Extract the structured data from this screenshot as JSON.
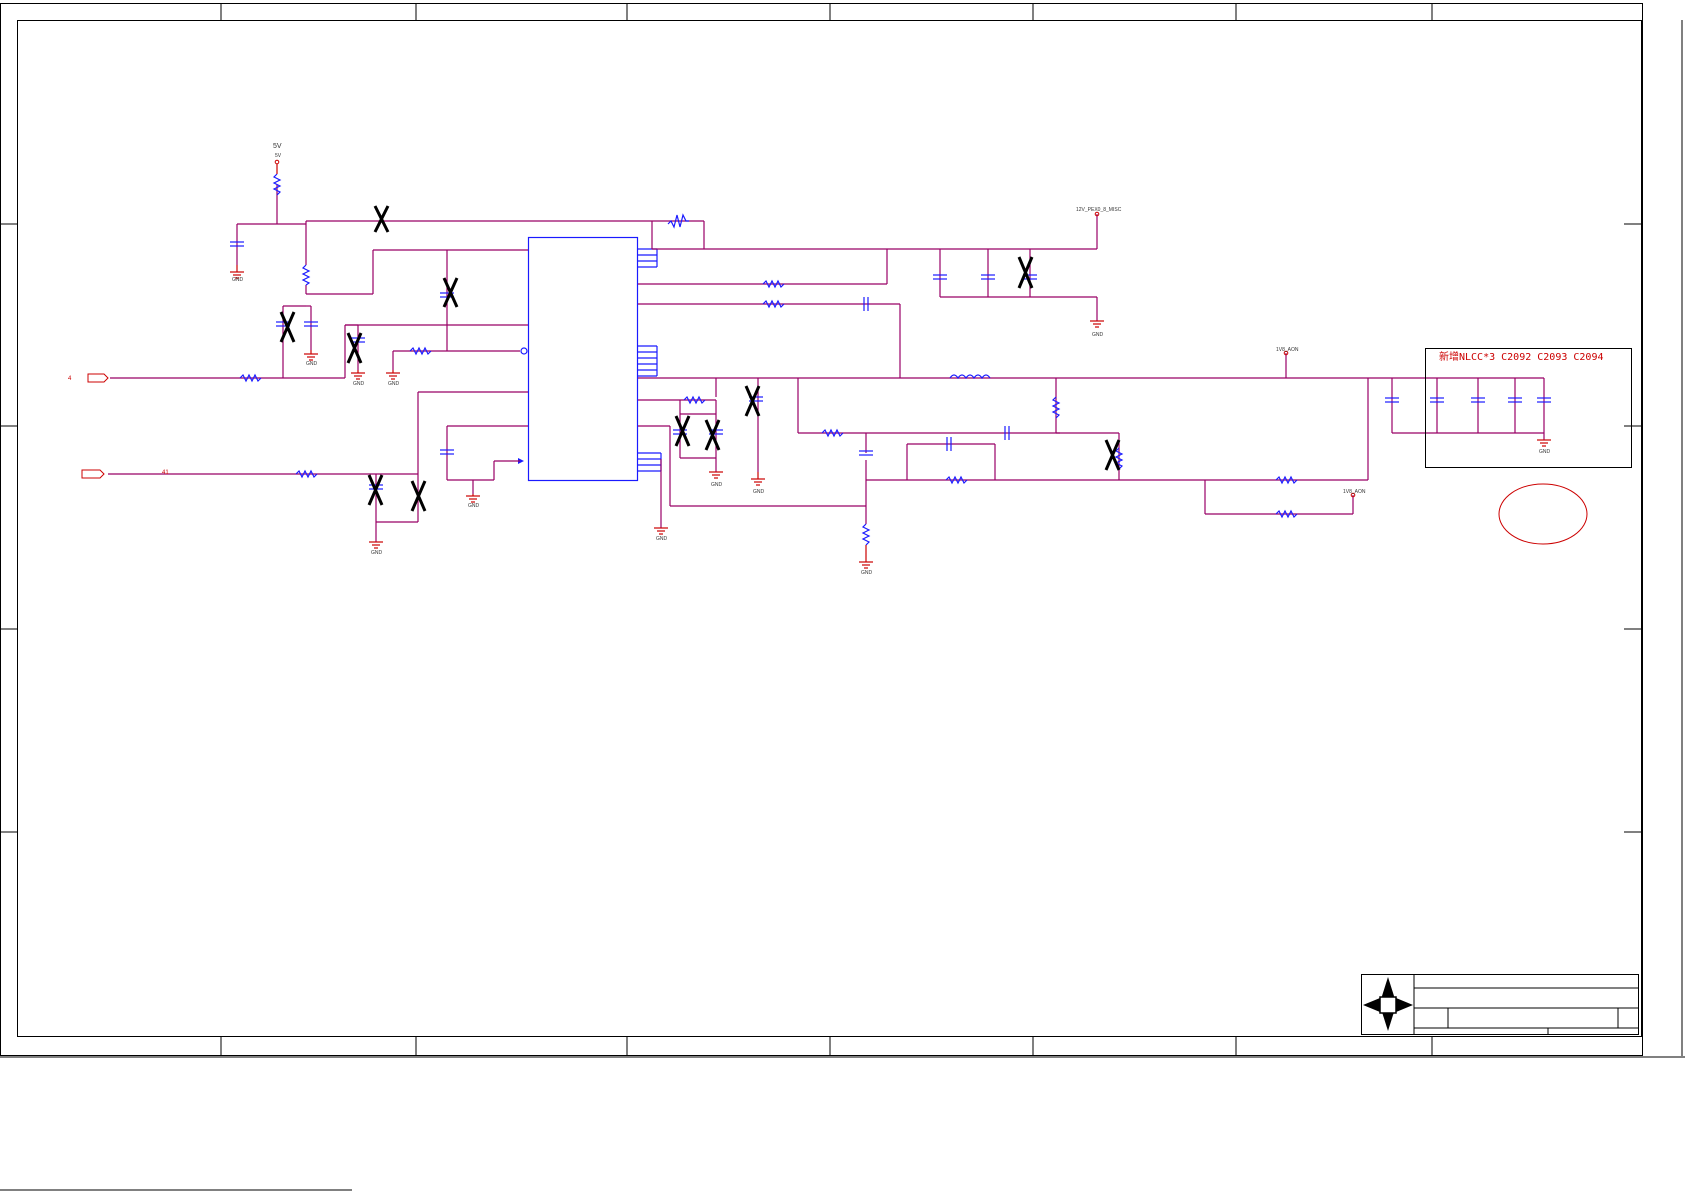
{
  "labels": {
    "net_5v_main": "5V",
    "net_5v_small": "5V",
    "net_12v": "12V_PEX0_8_MISC",
    "net_1v8_top": "1V8_AON",
    "net_1v8_bottom": "1V8_AON",
    "port_left_top_num": "4",
    "port_left_bottom_num": "41",
    "note": "新增NLCC*3 C2092 C2093 C2094"
  },
  "ground_label": "GND",
  "colors": {
    "wire": "#990066",
    "component": "#1a1aff",
    "power": "#cc0000",
    "frame": "#000000"
  },
  "icons": [
    "ground-icon",
    "capacitor-symbol",
    "resistor-symbol",
    "inductor-symbol",
    "no-stuff-mark",
    "title-block-logo-icon"
  ]
}
